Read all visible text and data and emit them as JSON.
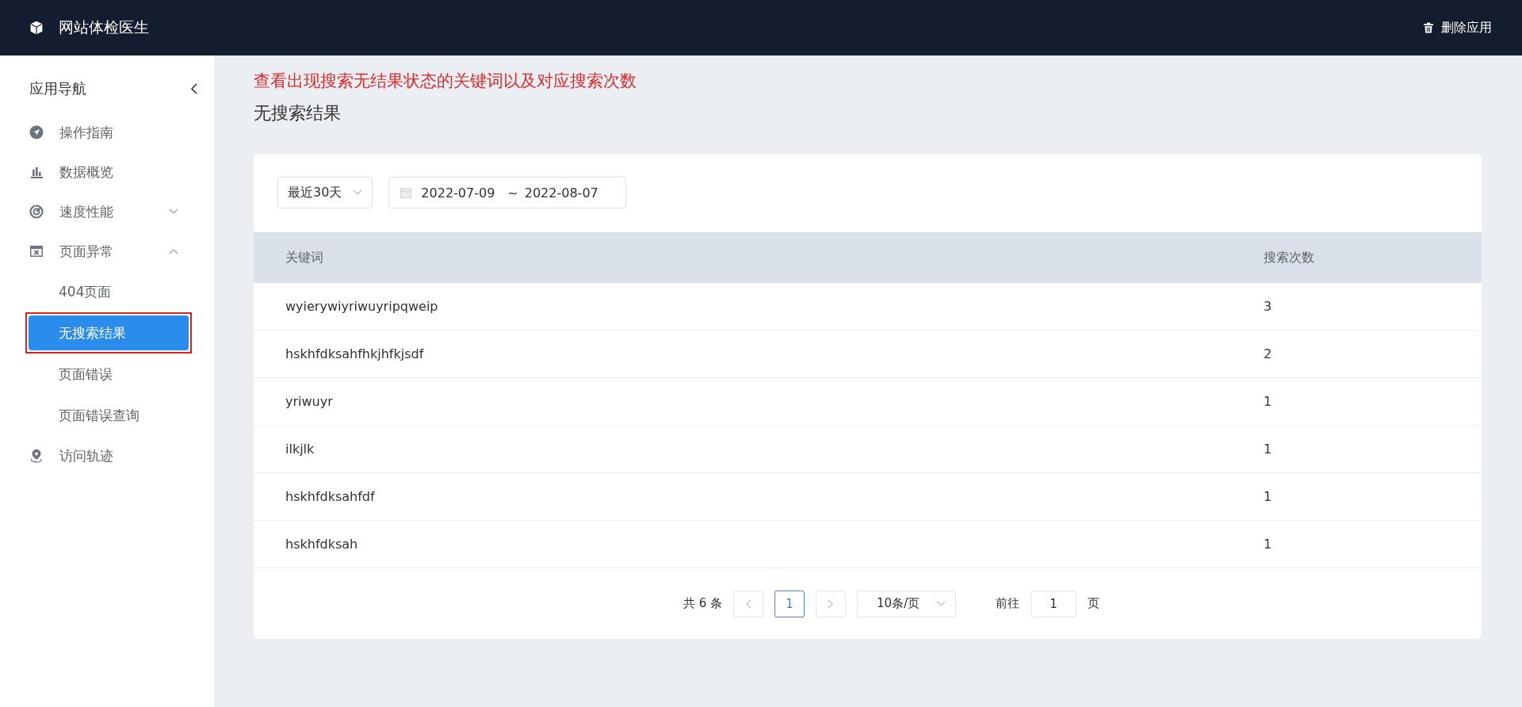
{
  "header": {
    "title": "网站体检医生",
    "action": "删除应用"
  },
  "sidebar": {
    "title": "应用导航",
    "items": [
      {
        "label": "操作指南",
        "selected": false
      },
      {
        "label": "数据概览",
        "selected": false
      },
      {
        "label": "速度性能",
        "selected": false,
        "expanded": false
      },
      {
        "label": "页面异常",
        "selected": false,
        "expanded": true,
        "children": [
          {
            "label": "404页面",
            "selected": false,
            "annotated": false
          },
          {
            "label": "无搜索结果",
            "selected": true,
            "annotated": true
          },
          {
            "label": "页面错误",
            "selected": false,
            "annotated": false
          },
          {
            "label": "页面错误查询",
            "selected": false,
            "annotated": false
          }
        ]
      },
      {
        "label": "访问轨迹",
        "selected": false
      }
    ]
  },
  "annotation": "查看出现搜索无结果状态的关键词以及对应搜索次数",
  "page_title": "无搜索结果",
  "filters": {
    "range": "最近30天",
    "start_date": "2022-07-09",
    "separator": "~",
    "end_date": "2022-08-07"
  },
  "table": {
    "columns": [
      "关键词",
      "搜索次数"
    ],
    "rows": [
      [
        "wyierywiyriwuyripqweip",
        "3"
      ],
      [
        "hskhfdksahfhkjhfkjsdf",
        "2"
      ],
      [
        "yriwuyr",
        "1"
      ],
      [
        "ilkjlk",
        "1"
      ],
      [
        "hskhfdksahfdf",
        "1"
      ],
      [
        "hskhfdksah",
        "1"
      ]
    ]
  },
  "pagination": {
    "total": "共 6 条",
    "pages": [
      {
        "label": "1",
        "selected": true
      }
    ],
    "page_size": "10条/页",
    "goto_label": "前往",
    "goto_value": "1",
    "goto_suffix": "页"
  }
}
